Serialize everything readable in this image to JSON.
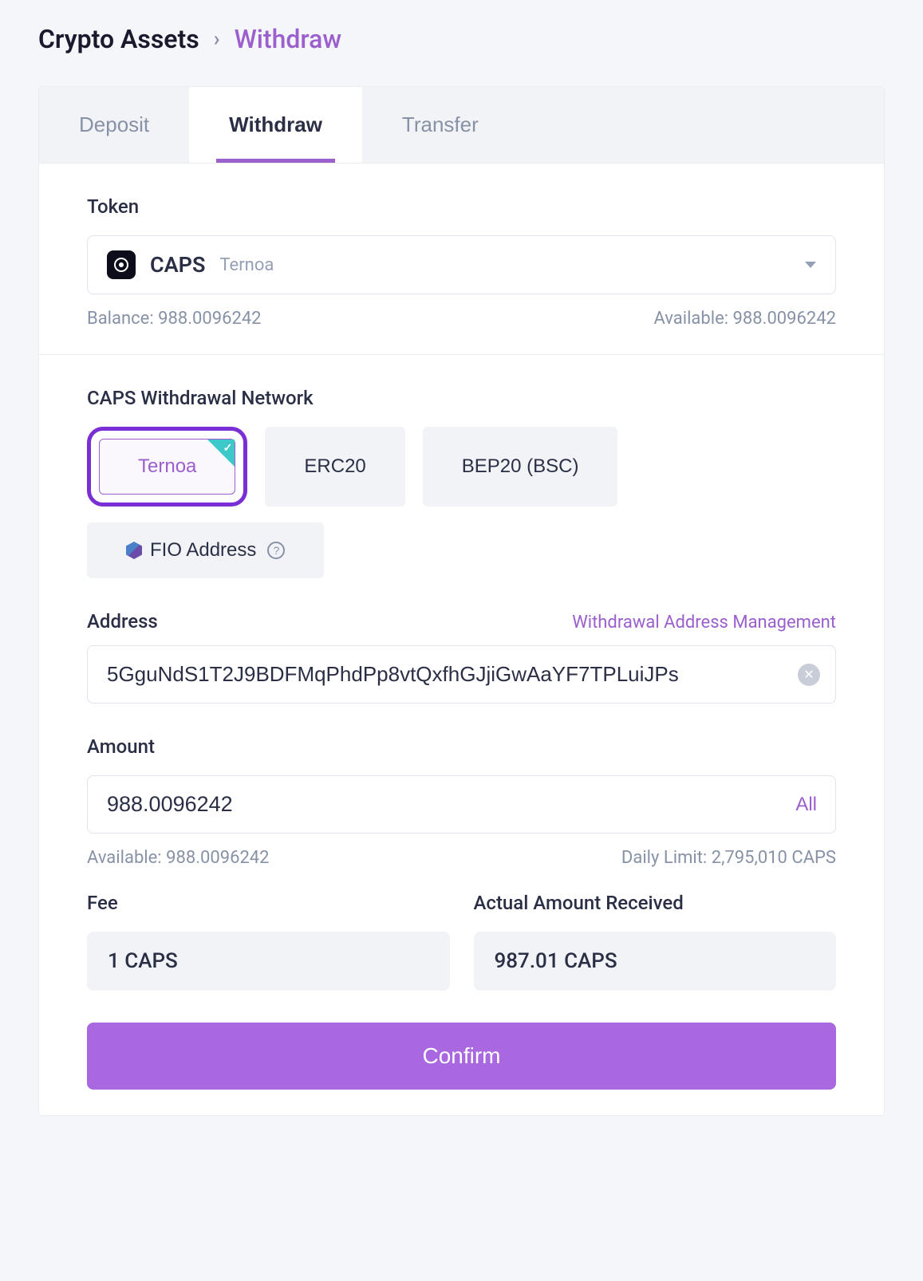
{
  "breadcrumb": {
    "root": "Crypto Assets",
    "current": "Withdraw"
  },
  "tabs": {
    "deposit": "Deposit",
    "withdraw": "Withdraw",
    "transfer": "Transfer"
  },
  "token": {
    "label": "Token",
    "symbol": "CAPS",
    "name": "Ternoa",
    "balance_label": "Balance: 988.0096242",
    "available_label": "Available: 988.0096242"
  },
  "network": {
    "label": "CAPS Withdrawal Network",
    "options": {
      "ternoa": "Ternoa",
      "erc20": "ERC20",
      "bep20": "BEP20 (BSC)",
      "fio": "FIO Address"
    }
  },
  "address": {
    "label": "Address",
    "management_link": "Withdrawal Address Management",
    "value": "5GguNdS1T2J9BDFMqPhdPp8vtQxfhGJjiGwAaYF7TPLuiJPs"
  },
  "amount": {
    "label": "Amount",
    "value": "988.0096242",
    "all_label": "All",
    "available_label": "Available: 988.0096242",
    "daily_limit_label": "Daily Limit: 2,795,010 CAPS"
  },
  "fee": {
    "label": "Fee",
    "value": "1 CAPS"
  },
  "received": {
    "label": "Actual Amount Received",
    "value": "987.01 CAPS"
  },
  "confirm_label": "Confirm"
}
